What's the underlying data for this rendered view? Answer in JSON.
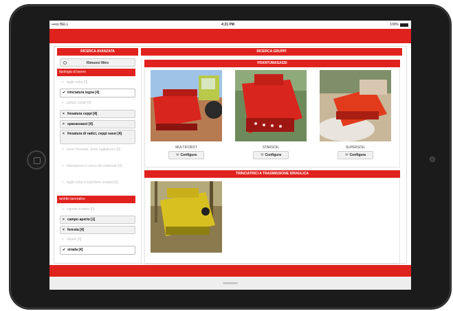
{
  "status_bar": {
    "carrier": "•••oo BELL",
    "time": "4:21 PM",
    "battery": "100%"
  },
  "headers": {
    "advanced_search": "RICERCA AVANZATA",
    "groups_search": "RICERCA GRUPPI"
  },
  "sidebar": {
    "remove_filter_label": "Rimuovi filtro",
    "sections": [
      {
        "title": "tipologia di lavoro",
        "filters": [
          {
            "label": "taglio erba [0]",
            "state": "disabled"
          },
          {
            "label": "trinciatura legna [4]",
            "state": "selected"
          },
          {
            "label": "pulizia canali [0]",
            "state": "disabled"
          },
          {
            "label": "fresatura ceppi [4]",
            "state": "available"
          },
          {
            "label": "spacassassi [4]",
            "state": "available"
          },
          {
            "label": "fresatura di radici, ceppi sassi [4]",
            "state": "available"
          },
          {
            "label": "lavori forestali , linee tagliafuoco [0]",
            "state": "disabled"
          },
          {
            "label": "triturazione e carico dei materiale [0]",
            "state": "disabled"
          },
          {
            "label": "taglio erba in banchine stradali [0]",
            "state": "disabled"
          }
        ]
      },
      {
        "title": "ambito lavorativo",
        "filters": [
          {
            "label": "vigneto-frutteto [0]",
            "state": "disabled"
          },
          {
            "label": "campo aperto [1]",
            "state": "available"
          },
          {
            "label": "foresta [4]",
            "state": "available"
          },
          {
            "label": "oliveto [0]",
            "state": "disabled"
          },
          {
            "label": "strada [4]",
            "state": "selected"
          }
        ]
      }
    ]
  },
  "groups": [
    {
      "title": "FRANTUMASASSI",
      "products": [
        {
          "name": "MULTIFORST",
          "button": "Configura"
        },
        {
          "name": "STARSOIL",
          "button": "Configura"
        },
        {
          "name": "SUPERSOIL",
          "button": "Configura"
        }
      ]
    },
    {
      "title": "TRINCIATRICI A TRASMISSIONE IDRAULICA",
      "products": [
        {
          "name": "",
          "button": ""
        }
      ]
    }
  ],
  "icons": {
    "remove_filter": "circle-x-icon",
    "check": "checkmark-icon",
    "remove": "x-icon",
    "configure": "wrench-icon"
  },
  "colors": {
    "accent": "#e0221e",
    "bezel": "#1b1b1b"
  }
}
